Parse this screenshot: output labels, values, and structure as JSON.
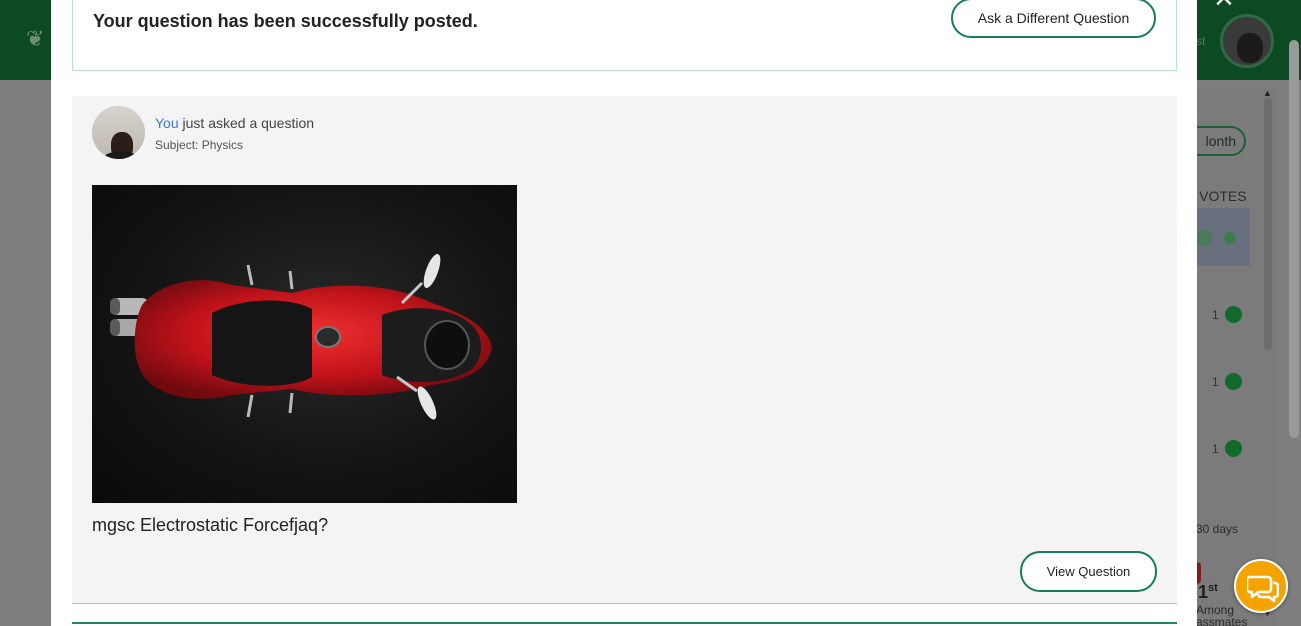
{
  "modal": {
    "success_message": "Your question has been successfully posted.",
    "ask_different_label": "Ask a Different Question",
    "close_glyph": "×"
  },
  "question": {
    "asker": "You",
    "asked_suffix": " just asked a question",
    "subject": "Subject: Physics",
    "text": "mgsc Electrostatic Forcefjaq?",
    "view_label": "View Question",
    "image_description_icon": "motorcycle-photo"
  },
  "background": {
    "header_text": "st",
    "month_label": "lonth",
    "votes_label": "L VOTES",
    "vote_rows": [
      {
        "count": "1"
      },
      {
        "count": "1"
      },
      {
        "count": "1"
      }
    ],
    "days_label": "30 days",
    "rank": "1",
    "rank_suffix": "st",
    "among_label": "Among",
    "classmates_label": "assmates"
  },
  "colors": {
    "accent_green": "#167c5b",
    "link_blue": "#3a78d8",
    "chat_orange": "#f5a300"
  }
}
